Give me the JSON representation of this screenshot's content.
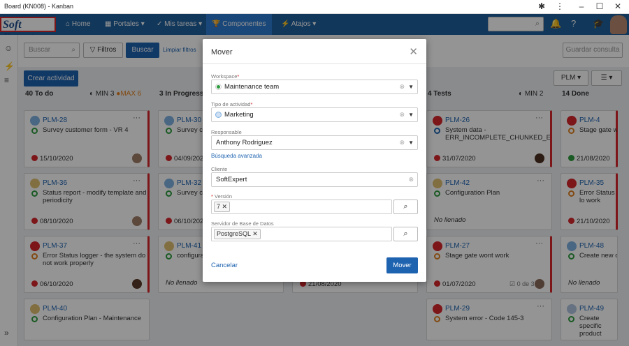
{
  "window": {
    "title": "Board (KN008) - Kanban"
  },
  "logo": {
    "text": "Soft Expert"
  },
  "nav": {
    "home": "Home",
    "portales": "Portales",
    "mis_tareas": "Mis tareas",
    "componentes": "Componentes",
    "atajos": "Atajos"
  },
  "filters": {
    "search_placeholder": "Buscar",
    "filtros": "Filtros",
    "buscar": "Buscar",
    "limpiar": "Limpiar filtros",
    "guardar": "Guardar consulta"
  },
  "toolbar": {
    "create": "Crear actividad",
    "plm": "PLM"
  },
  "columns": [
    {
      "count": "40",
      "name": "To do",
      "min": "MIN 3",
      "max": "MAX 6"
    },
    {
      "count": "3",
      "name": "In Progress"
    },
    {
      "count": "4",
      "name": "Tests",
      "min": "MIN 2"
    },
    {
      "count": "14",
      "name": "Done"
    }
  ],
  "cards": [
    {
      "id": "PLM-28",
      "title": "Survey customer form - VR 4",
      "date": "15/10/2020"
    },
    {
      "id": "PLM-36",
      "title": "Status report - modify template and periodicity",
      "date": "08/10/2020"
    },
    {
      "id": "PLM-37",
      "title": "Error Status logger - the system do not work properly",
      "date": "06/10/2020"
    },
    {
      "id": "PLM-40",
      "title": "Configuration Plan - Maintenance"
    },
    {
      "id": "PLM-30",
      "title": "Survey cus",
      "date": "04/09/2020"
    },
    {
      "id": "PLM-32",
      "title": "Survey cus",
      "date": "06/10/2020"
    },
    {
      "id": "PLM-41",
      "title": "configurati",
      "empty": "No llenado"
    },
    {
      "date": "21/08/2020"
    },
    {
      "id": "PLM-26",
      "title": "System data - ERR_INCOMPLETE_CHUNKED_ENC",
      "date": "31/07/2020"
    },
    {
      "id": "PLM-42",
      "title": "Configuration Plan",
      "empty": "No llenado"
    },
    {
      "id": "PLM-27",
      "title": "Stage gate wont work",
      "date": "01/07/2020",
      "checklist": "0 de 3"
    },
    {
      "id": "PLM-29",
      "title": "System error - Code 145-3"
    },
    {
      "id": "PLM-4",
      "title": "Stage gate wor",
      "date": "21/08/2020"
    },
    {
      "id": "PLM-35",
      "title": "Error Status lo work properly",
      "date": "21/10/2020"
    },
    {
      "id": "PLM-48",
      "title": "Create new co",
      "empty": "No llenado"
    },
    {
      "id": "PLM-49",
      "title": "Create specific product"
    }
  ],
  "modal": {
    "title": "Mover",
    "workspace_label": "Workspace",
    "workspace_value": "Maintenance team",
    "tipo_label": "Tipo de actividad",
    "tipo_value": "Marketing",
    "responsable_label": "Responsable",
    "responsable_value": "Anthony Rodriguez",
    "busqueda": "Búsqueda avanzada",
    "cliente_label": "Cliente",
    "cliente_value": "SoftExpert",
    "version_label": "Versión",
    "version_tag": "7",
    "servidor_label": "Servidor de Base de Datos",
    "servidor_tag": "PostgreSQL",
    "required_mark": "*",
    "cancel": "Cancelar",
    "ok": "Mover"
  },
  "colors": {
    "nav": "#1e5f9e",
    "accent": "#1e63b0",
    "danger": "#d6262c"
  }
}
